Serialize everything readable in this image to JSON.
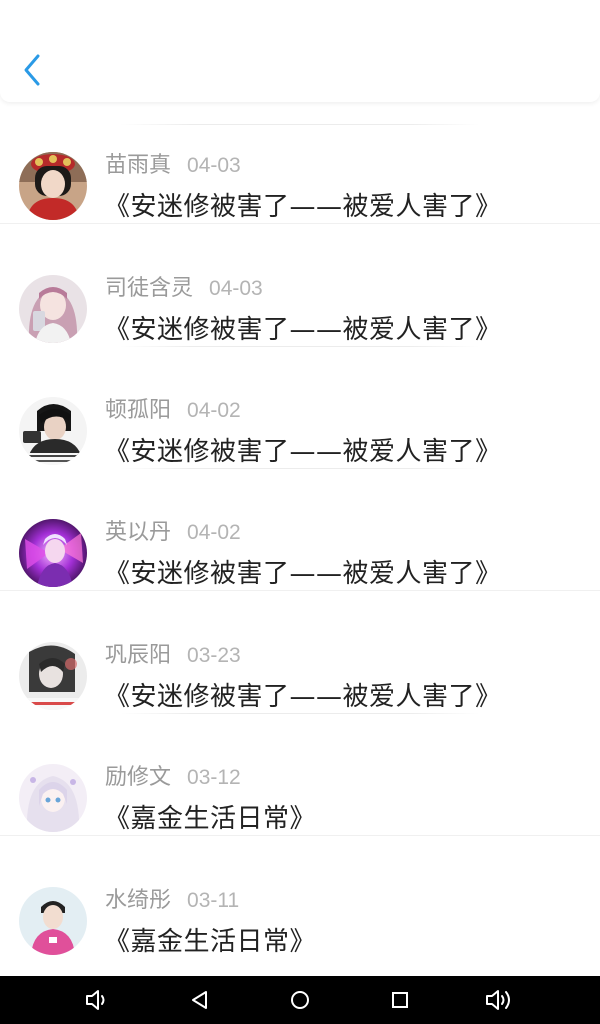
{
  "header": {
    "back_icon": "chevron-left-icon",
    "accent_color": "#2a9ae6"
  },
  "comments": [
    {
      "username": "苗雨真",
      "date": "04-03",
      "title": "《安迷修被害了——被爱人害了》",
      "avatar": "red-traditional-dress-girl"
    },
    {
      "username": "司徒含灵",
      "date": "04-03",
      "title": "《安迷修被害了——被爱人害了》",
      "avatar": "pink-hair-girl-selfie"
    },
    {
      "username": "顿孤阳",
      "date": "04-02",
      "title": "《安迷修被害了——被爱人害了》",
      "avatar": "boy-with-phone-caption"
    },
    {
      "username": "英以丹",
      "date": "04-02",
      "title": "《安迷修被害了——被爱人害了》",
      "avatar": "purple-neon-anime"
    },
    {
      "username": "巩辰阳",
      "date": "03-23",
      "title": "《安迷修被害了——被爱人害了》",
      "avatar": "monochrome-girl-caption"
    },
    {
      "username": "励修文",
      "date": "03-12",
      "title": "《嘉金生活日常》",
      "avatar": "white-hair-anime-girl"
    },
    {
      "username": "水绮彤",
      "date": "03-11",
      "title": "《嘉金生活日常》",
      "avatar": "boy-pink-hoodie"
    }
  ],
  "navbar": {
    "buttons": [
      "volume-down-icon",
      "back-triangle-icon",
      "home-circle-icon",
      "recents-square-icon",
      "volume-up-icon"
    ]
  }
}
